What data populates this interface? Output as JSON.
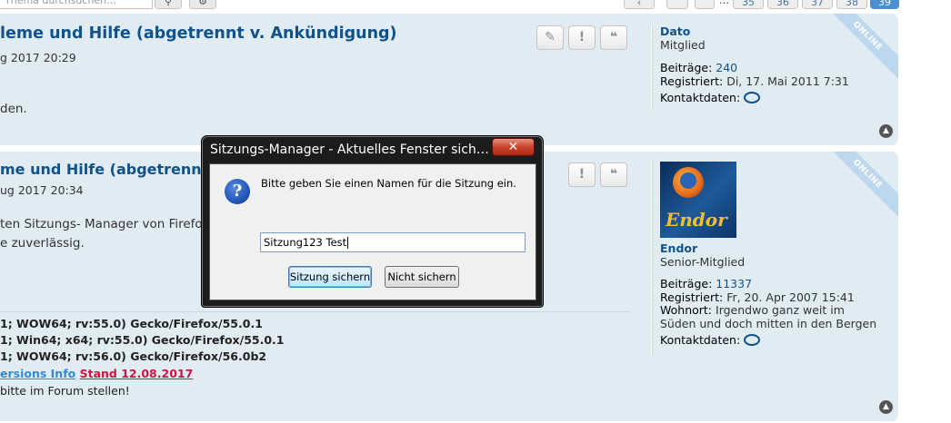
{
  "topbar": {
    "search_placeholder": "Thema durchsuchen…",
    "search_icon": "search-icon",
    "settings_icon": "gear-icon",
    "pagination": {
      "ellipsis": "…",
      "pages": [
        "35",
        "36",
        "37",
        "38",
        "39"
      ],
      "current": "39"
    }
  },
  "posts": [
    {
      "title": "leme und Hilfe (abgetrennt v. Ankündigung)",
      "date": "g 2017 20:29",
      "text": [
        "den."
      ],
      "buttons": [
        "edit-icon",
        "report-icon",
        "quote-icon"
      ],
      "user": {
        "name": "Dato",
        "rank": "Mitglied",
        "status": "ONLINE",
        "posts_label": "Beiträge:",
        "posts": "240",
        "registered_label": "Registriert:",
        "registered": "Di, 17. Mai 2011 7:31",
        "contact_label": "Kontaktdaten:"
      }
    },
    {
      "title": "me und Hilfe (abgetrennt v.",
      "date": "ug 2017 20:34",
      "text": [
        "ten Sitzungs- Manager von Firefo",
        "e zuverlässig."
      ],
      "signature": [
        "1; WOW64; rv:55.0) Gecko/Firefox/55.0.1",
        "1; Win64; x64; rv:55.0) Gecko/Firefox/55.0.1",
        "1; WOW64; rv:56.0) Gecko/Firefox/56.0b2"
      ],
      "sig_link": "ersions Info",
      "sig_stand": "Stand 12.08.2017",
      "sig_note": "bitte im Forum stellen!",
      "buttons": [
        "report-icon",
        "quote-icon"
      ],
      "user": {
        "name": "Endor",
        "rank": "Senior-Mitglied",
        "status": "ONLINE",
        "avatar_text": "Endor",
        "posts_label": "Beiträge:",
        "posts": "11337",
        "registered_label": "Registriert:",
        "registered": "Fr, 20. Apr 2007 15:41",
        "residence_label": "Wohnort:",
        "residence": "Irgendwo ganz weit im",
        "residence2": "Süden und doch mitten in den Bergen",
        "contact_label": "Kontaktdaten:"
      }
    }
  ],
  "dialog": {
    "title": "Sitzungs-Manager - Aktuelles Fenster sich…",
    "close_label": "✕",
    "icon": "question-icon",
    "message": "Bitte geben Sie einen Namen für die Sitzung ein.",
    "input_value": "Sitzung123 Test",
    "save_label": "Sitzung sichern",
    "dont_save_label": "Nicht sichern"
  },
  "colors": {
    "post_bg": "#e1ebf2",
    "title": "#105289",
    "accent_page": "#4c8fd0",
    "online_ribbon": "#bdd7ee",
    "dialog_frame": "#1c1c1c"
  }
}
